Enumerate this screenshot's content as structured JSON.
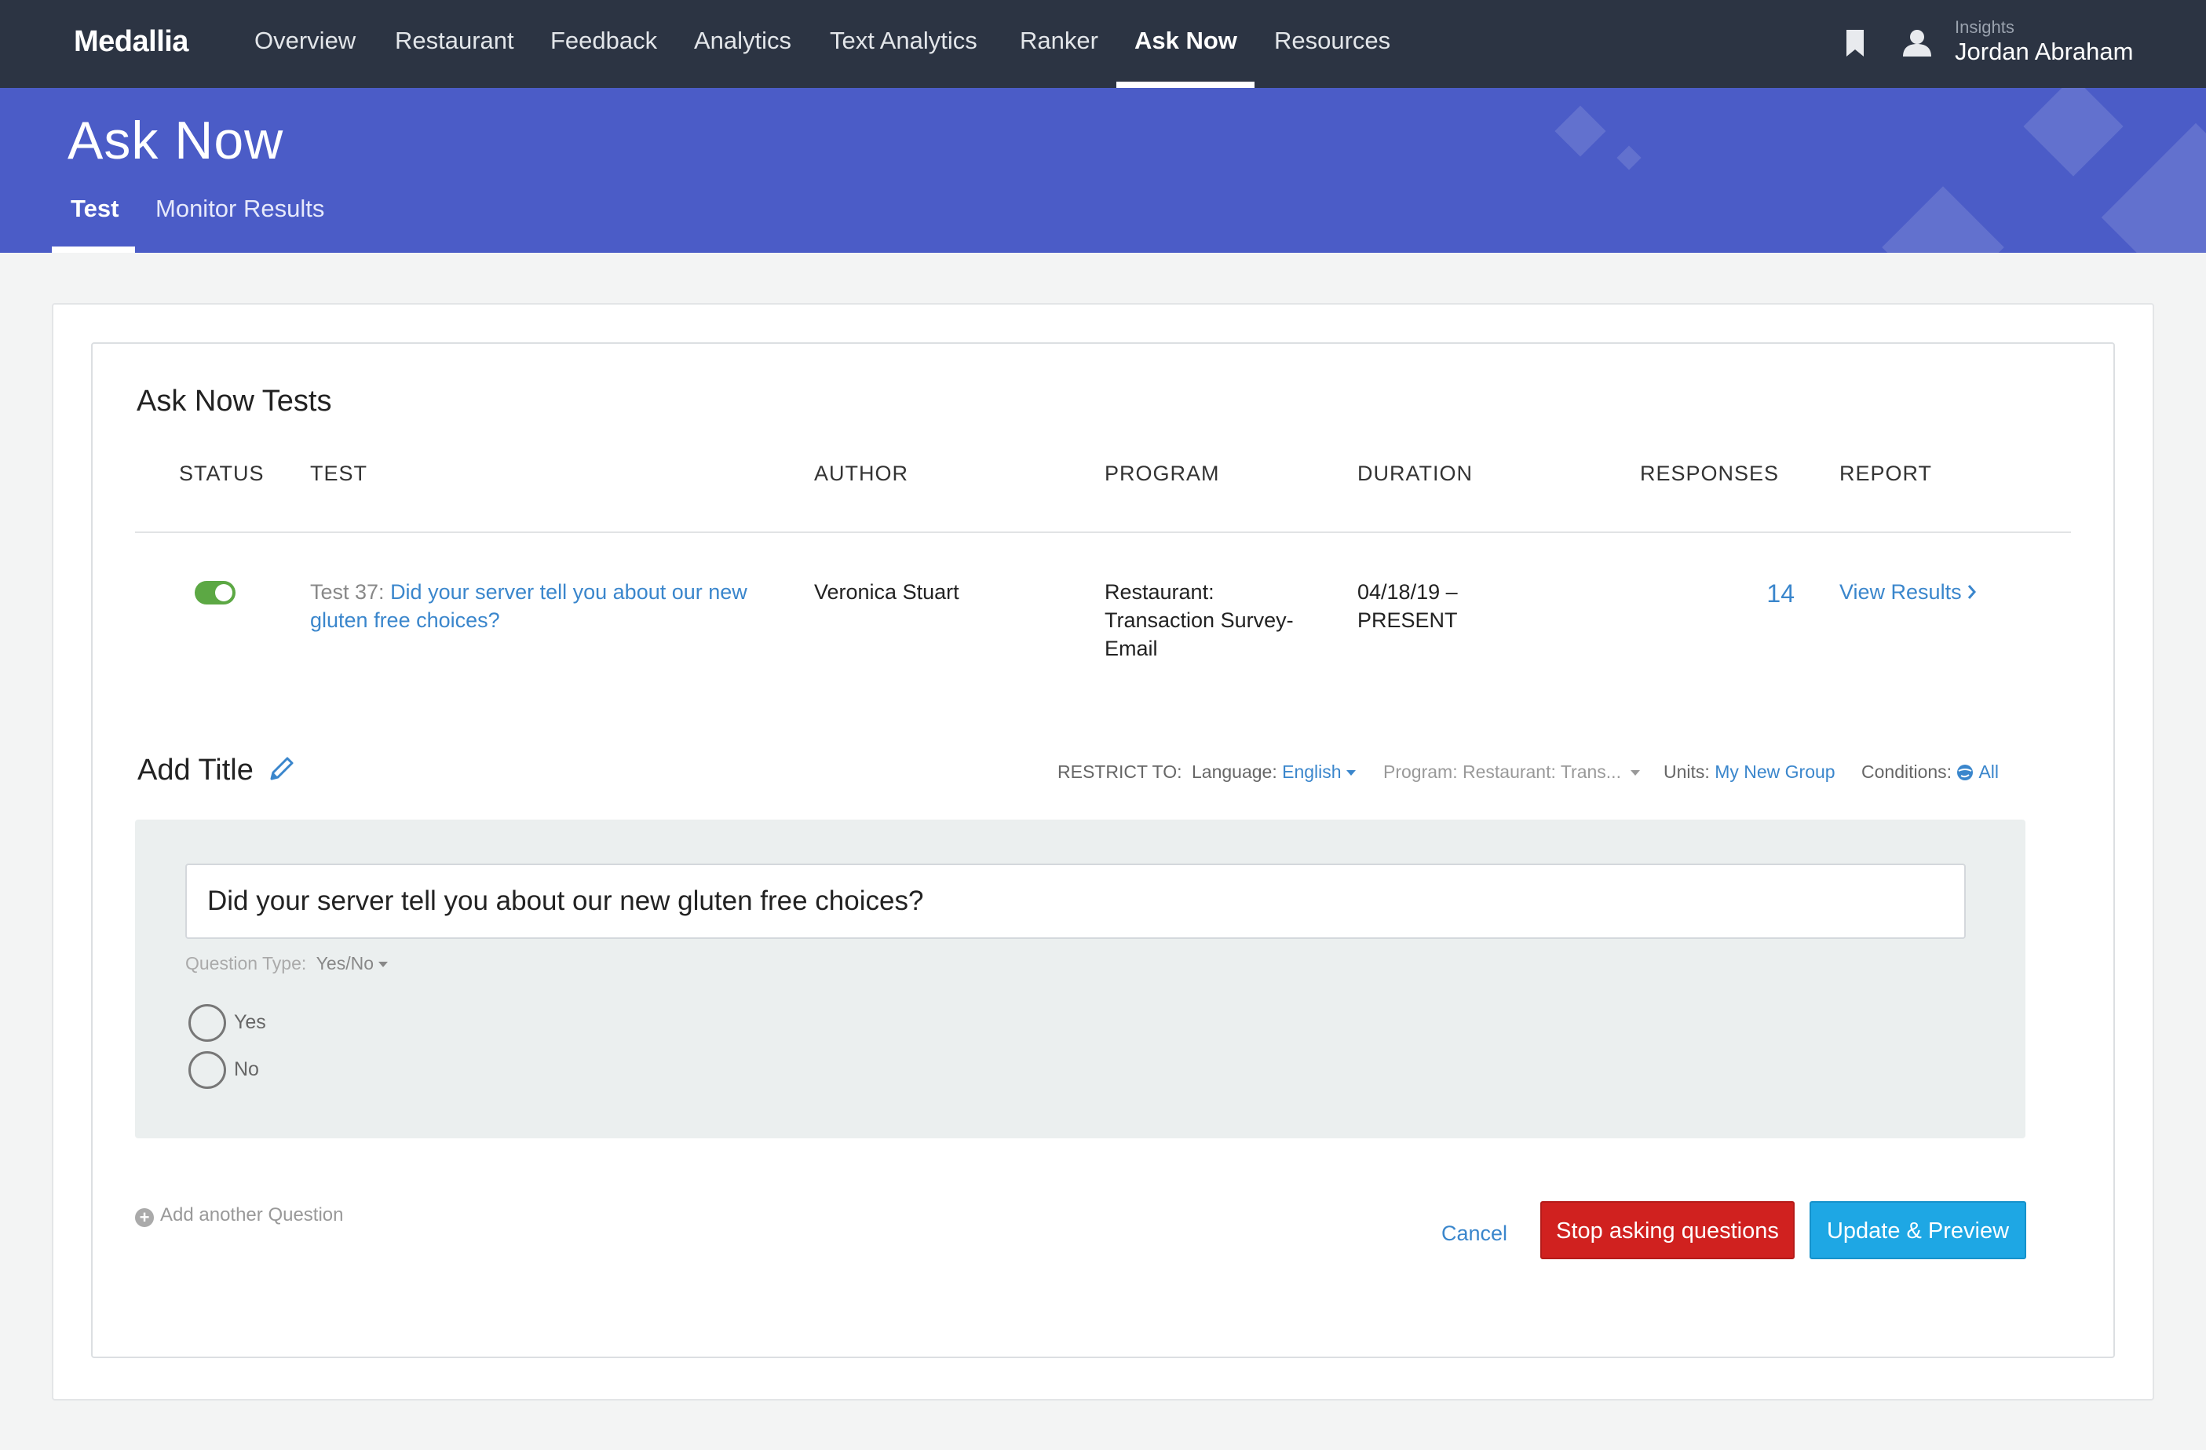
{
  "nav": {
    "logo": "Medallia",
    "items": [
      "Overview",
      "Restaurant",
      "Feedback",
      "Analytics",
      "Text Analytics",
      "Ranker",
      "Ask Now",
      "Resources"
    ],
    "active_index": 6,
    "user_sub": "Insights",
    "user_name": "Jordan Abraham"
  },
  "banner": {
    "title": "Ask Now",
    "tabs": [
      "Test",
      "Monitor Results"
    ],
    "active_tab": 0,
    "accent_color": "#4b5cc7"
  },
  "tests": {
    "title": "Ask Now Tests",
    "columns": [
      "STATUS",
      "TEST",
      "AUTHOR",
      "PROGRAM",
      "DURATION",
      "RESPONSES",
      "REPORT"
    ],
    "rows": [
      {
        "status_on": true,
        "test_prefix": "Test 37: ",
        "test_link": "Did your server tell you about our new gluten free choices?",
        "author": "Veronica Stuart",
        "program": "Restaurant: Transaction Survey-Email",
        "duration": "04/18/19 – PRESENT",
        "responses": "14",
        "report": "View Results"
      }
    ]
  },
  "editor": {
    "title": "Add Title",
    "restrict_label": "RESTRICT TO:",
    "language_label": "Language:",
    "language_value": "English",
    "program_label": "Program:",
    "program_value": "Restaurant: Trans...",
    "units_label": "Units:",
    "units_value": "My New Group",
    "conditions_label": "Conditions:",
    "conditions_value": "All",
    "question_text": "Did your server tell you about our new gluten free choices?",
    "question_type_label": "Question Type:",
    "question_type_value": "Yes/No",
    "options": [
      "Yes",
      "No"
    ],
    "add_question": "Add another Question"
  },
  "actions": {
    "cancel": "Cancel",
    "stop": "Stop asking questions",
    "update": "Update & Preview",
    "stop_color": "#d0211f",
    "update_color": "#1ea7e4"
  }
}
